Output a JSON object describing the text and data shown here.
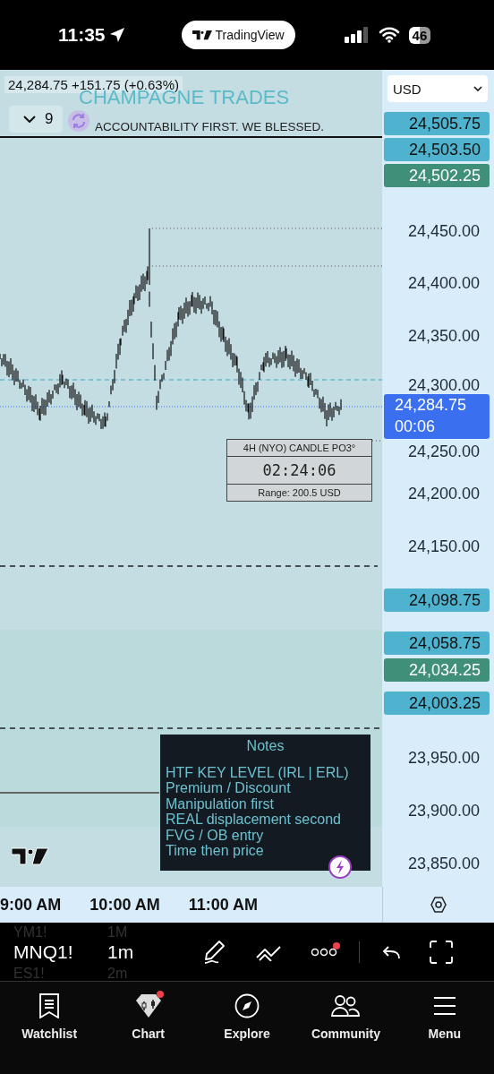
{
  "status_bar": {
    "time": "11:35",
    "app_pill": "TradingView",
    "battery": "46"
  },
  "chart": {
    "quote": "24,284.75 +151.75 (+0.63%)",
    "title": "CHAMPAGNE TRADES",
    "subtitle": "ACCOUNTABILITY FIRST. WE BLESSED.",
    "indicator_count": "9",
    "currency": "USD",
    "price_axis": [
      "24,450.00",
      "24,400.00",
      "24,350.00",
      "24,300.00",
      "24,250.00",
      "24,200.00",
      "24,150.00",
      "23,950.00",
      "23,900.00",
      "23,850.00"
    ],
    "price_tags": [
      {
        "kind": "level",
        "price": "24,505.75",
        "color": "#4fb3cf"
      },
      {
        "kind": "level",
        "price": "24,503.50",
        "color": "#4fb3cf"
      },
      {
        "kind": "level",
        "price": "24,502.25",
        "color": "#3f8f79"
      },
      {
        "kind": "current",
        "price": "24,284.75",
        "countdown": "00:06",
        "color": "#3a6ff0"
      },
      {
        "kind": "level",
        "price": "24,098.75",
        "color": "#4fb3cf"
      },
      {
        "kind": "level",
        "price": "24,058.75",
        "color": "#4fb3cf"
      },
      {
        "kind": "level",
        "price": "24,034.25",
        "color": "#3f8f79"
      },
      {
        "kind": "level",
        "price": "24,003.25",
        "color": "#4fb3cf"
      }
    ],
    "timer_box": {
      "title": "4H (NYO) CANDLE PO3°",
      "time": "02:24:06",
      "range": "Range: 200.5 USD"
    },
    "notes": {
      "title": "Notes",
      "lines": [
        "HTF KEY LEVEL (IRL | ERL)",
        "Premium / Discount",
        "Manipulation first",
        "REAL displacement second",
        "FVG / OB entry",
        "Time then price"
      ]
    },
    "time_axis": [
      "9:00 AM",
      "10:00 AM",
      "11:00 AM"
    ]
  },
  "toolbar": {
    "symbols": [
      {
        "label": "YM1!",
        "selected": false
      },
      {
        "label": "MNQ1!",
        "selected": true
      },
      {
        "label": "ES1!",
        "selected": false
      }
    ],
    "intervals": [
      {
        "label": "1M",
        "selected": false
      },
      {
        "label": "1m",
        "selected": true
      },
      {
        "label": "2m",
        "selected": false
      }
    ],
    "more_badge": true
  },
  "tabs": [
    {
      "kind": "watchlist",
      "label": "Watchlist",
      "badge": false
    },
    {
      "kind": "chart",
      "label": "Chart",
      "badge": true
    },
    {
      "kind": "explore",
      "label": "Explore",
      "badge": false
    },
    {
      "kind": "community",
      "label": "Community",
      "badge": false
    },
    {
      "kind": "menu",
      "label": "Menu",
      "badge": false
    }
  ]
}
